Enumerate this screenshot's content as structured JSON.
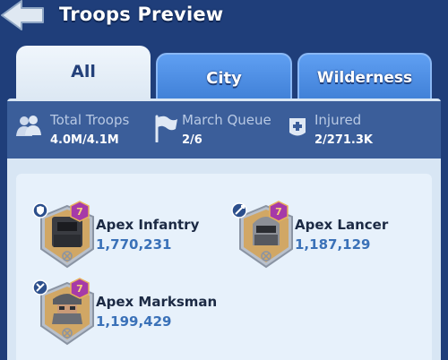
{
  "header": {
    "title": "Troops Preview"
  },
  "tabs": [
    {
      "label": "All",
      "active": true
    },
    {
      "label": "City",
      "active": false
    },
    {
      "label": "Wilderness",
      "active": false
    }
  ],
  "stats": [
    {
      "icon": "troops-icon",
      "label": "Total Troops",
      "value": "4.0M/4.1M"
    },
    {
      "icon": "flag-icon",
      "label": "March Queue",
      "value": "2/6"
    },
    {
      "icon": "medical-cross-icon",
      "label": "Injured",
      "value": "2/271.3K"
    }
  ],
  "troops": [
    {
      "name": "Apex Infantry",
      "count": "1,770,231",
      "tier": "7",
      "class_icon": "shield-icon"
    },
    {
      "name": "Apex Lancer",
      "count": "1,187,129",
      "tier": "7",
      "class_icon": "lance-icon"
    },
    {
      "name": "Apex Marksman",
      "count": "1,199,429",
      "tier": "7",
      "class_icon": "crosshair-icon"
    }
  ],
  "colors": {
    "background": "#1f3e7a",
    "tab_active": "#e7f1fb",
    "tab_inactive": "#4f90e8",
    "stats_bar": "#3b5e9a",
    "troop_count": "#3a71b8",
    "tier_badge": "#a63aa8"
  }
}
